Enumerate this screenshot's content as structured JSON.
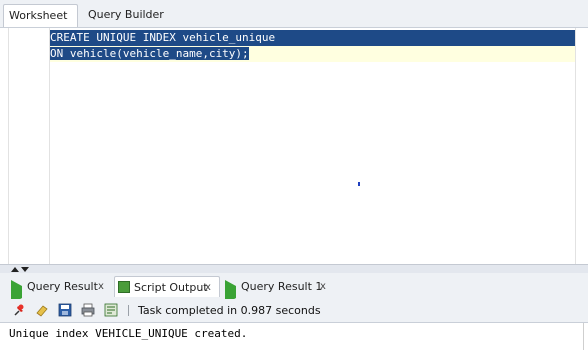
{
  "top_tabs": [
    "Worksheet",
    "Query Builder"
  ],
  "editor": {
    "line1": "CREATE UNIQUE INDEX vehicle_unique",
    "line2": "ON vehicle(vehicle_name,city);"
  },
  "bottom_tabs": [
    {
      "label": "Query Result",
      "close": "x",
      "icon": "query-result-icon"
    },
    {
      "label": "Script Output",
      "close": "x",
      "icon": "script-output-icon"
    },
    {
      "label": "Query Result 1",
      "close": "x",
      "icon": "query-result-icon"
    }
  ],
  "toolbar": {
    "icons": [
      "pin-icon",
      "eraser-icon",
      "save-icon",
      "print-icon",
      "script-icon"
    ],
    "status": "Task completed in 0.987 seconds"
  },
  "output": {
    "text": "Unique index VEHICLE_UNIQUE created."
  },
  "colors": {
    "selection": "#1e4a87",
    "current_line": "#ffffe0",
    "run_green": "#3aa335"
  }
}
